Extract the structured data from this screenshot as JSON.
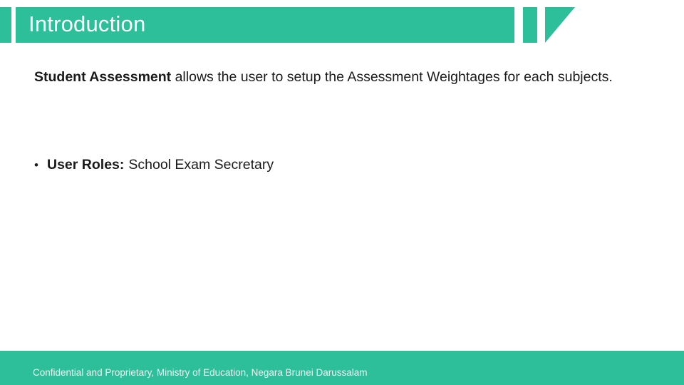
{
  "slide": {
    "title": "Introduction",
    "paragraph": {
      "bold_lead": "Student  Assessment",
      "rest": "  allows  the  user  to  setup  the  Assessment Weightages for each subjects."
    },
    "bullets": [
      {
        "marker": "•",
        "label": "User Roles:",
        "value": "School Exam Secretary"
      }
    ],
    "footer": "Confidential and Proprietary, Ministry of Education, Negara Brunei Darussalam",
    "accent_color": "#2cbf9a"
  }
}
